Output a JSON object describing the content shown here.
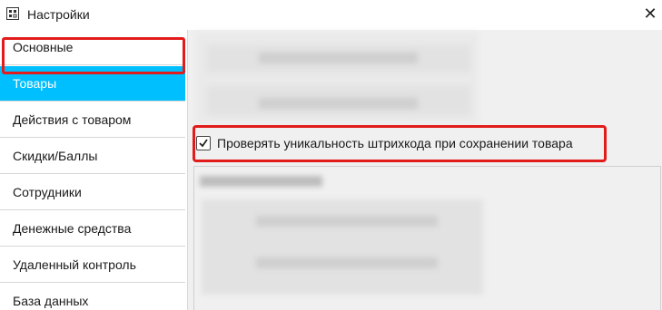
{
  "window": {
    "title": "Настройки",
    "close_label": "✕"
  },
  "sidebar": {
    "items": [
      {
        "label": "Основные",
        "selected": false
      },
      {
        "label": "Товары",
        "selected": true
      },
      {
        "label": "Действия с товаром",
        "selected": false
      },
      {
        "label": "Скидки/Баллы",
        "selected": false
      },
      {
        "label": "Сотрудники",
        "selected": false
      },
      {
        "label": "Денежные средства",
        "selected": false
      },
      {
        "label": "Удаленный контроль",
        "selected": false
      },
      {
        "label": "База данных",
        "selected": false
      }
    ]
  },
  "main": {
    "barcode_check": {
      "label": "Проверять уникальность штрихкода при сохранении товара",
      "checked": true
    }
  },
  "colors": {
    "selected_bg": "#00bfff",
    "highlight_frame": "#e21b1b"
  }
}
